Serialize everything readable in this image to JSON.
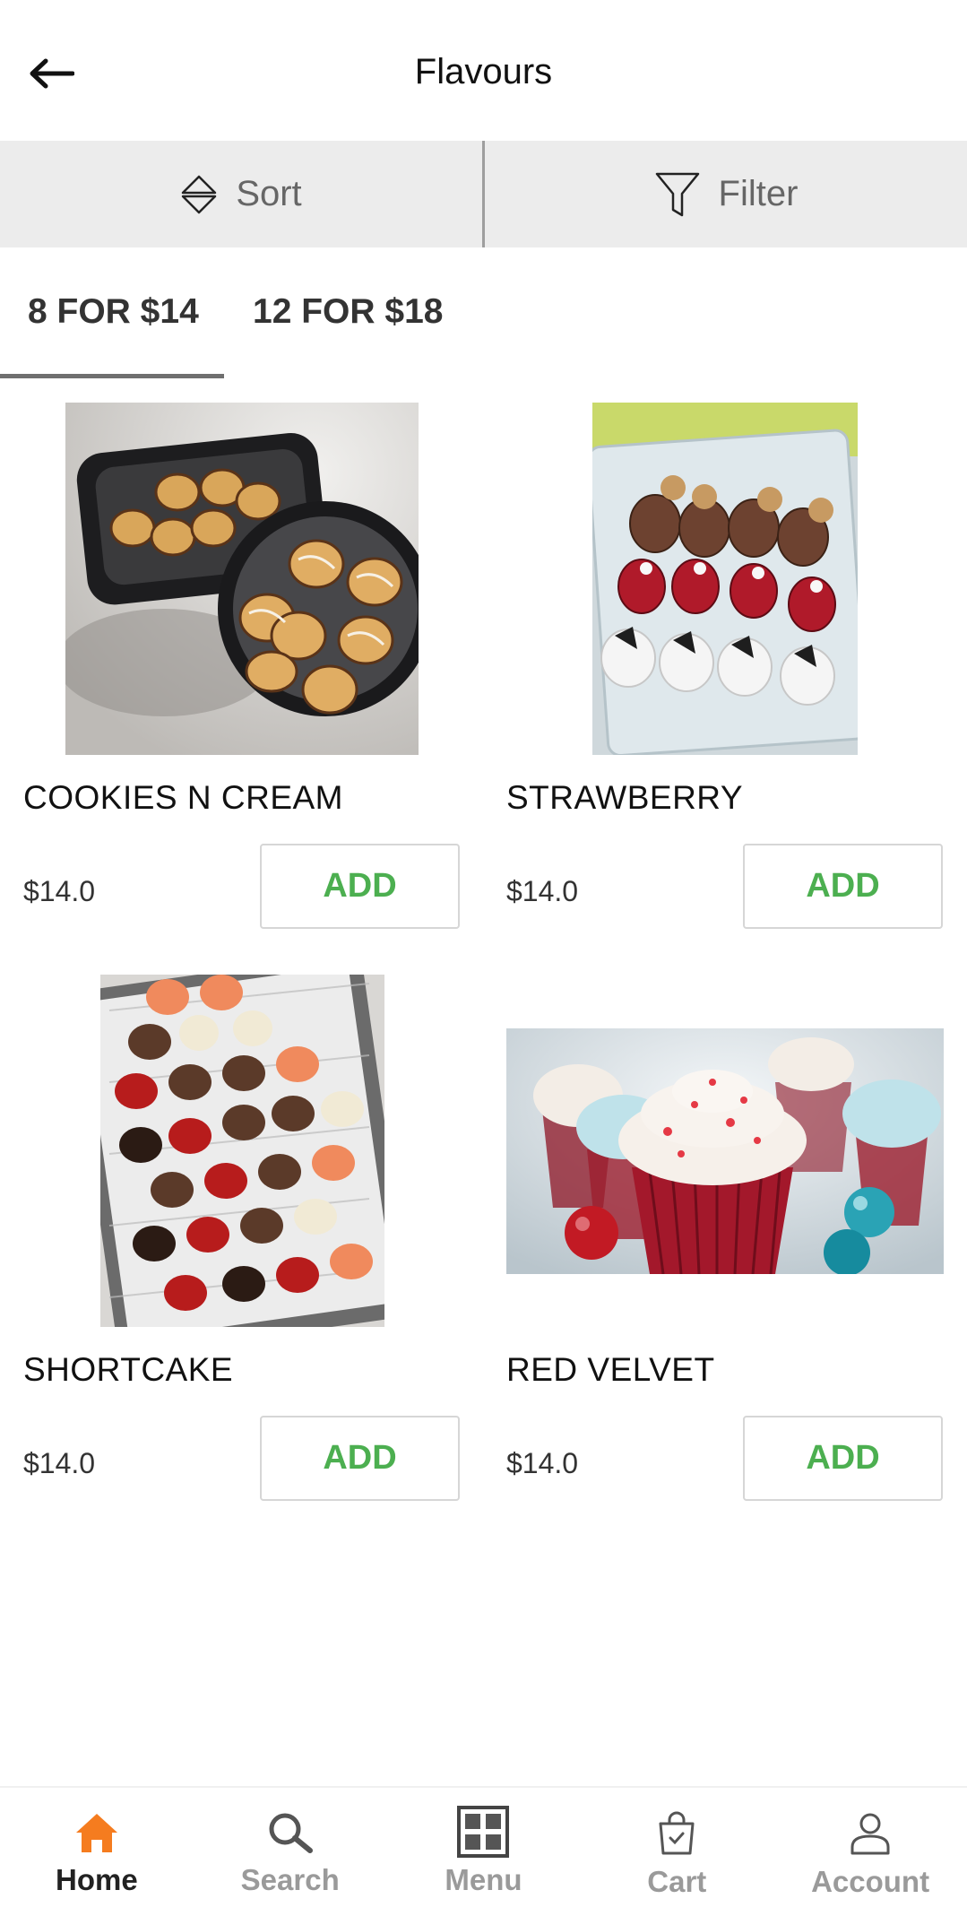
{
  "header": {
    "title": "Flavours"
  },
  "sortbar": {
    "sort_label": "Sort",
    "filter_label": "Filter"
  },
  "tabs": [
    {
      "label": "8 FOR $14",
      "active": true
    },
    {
      "label": "12 FOR $18",
      "active": false
    }
  ],
  "products": [
    {
      "name": "COOKIES N CREAM",
      "price": "$14.0",
      "add_label": "ADD"
    },
    {
      "name": "STRAWBERRY",
      "price": "$14.0",
      "add_label": "ADD"
    },
    {
      "name": "SHORTCAKE",
      "price": "$14.0",
      "add_label": "ADD"
    },
    {
      "name": "RED VELVET",
      "price": "$14.0",
      "add_label": "ADD"
    }
  ],
  "bottom_nav": [
    {
      "label": "Home",
      "icon": "home-icon",
      "active": true
    },
    {
      "label": "Search",
      "icon": "search-icon",
      "active": false
    },
    {
      "label": "Menu",
      "icon": "menu-grid-icon",
      "active": false
    },
    {
      "label": "Cart",
      "icon": "cart-bag-icon",
      "active": false
    },
    {
      "label": "Account",
      "icon": "account-icon",
      "active": false
    }
  ],
  "colors": {
    "accent": "#f57c1f",
    "add_green": "#4caf50",
    "sortbar_bg": "#ececec"
  }
}
